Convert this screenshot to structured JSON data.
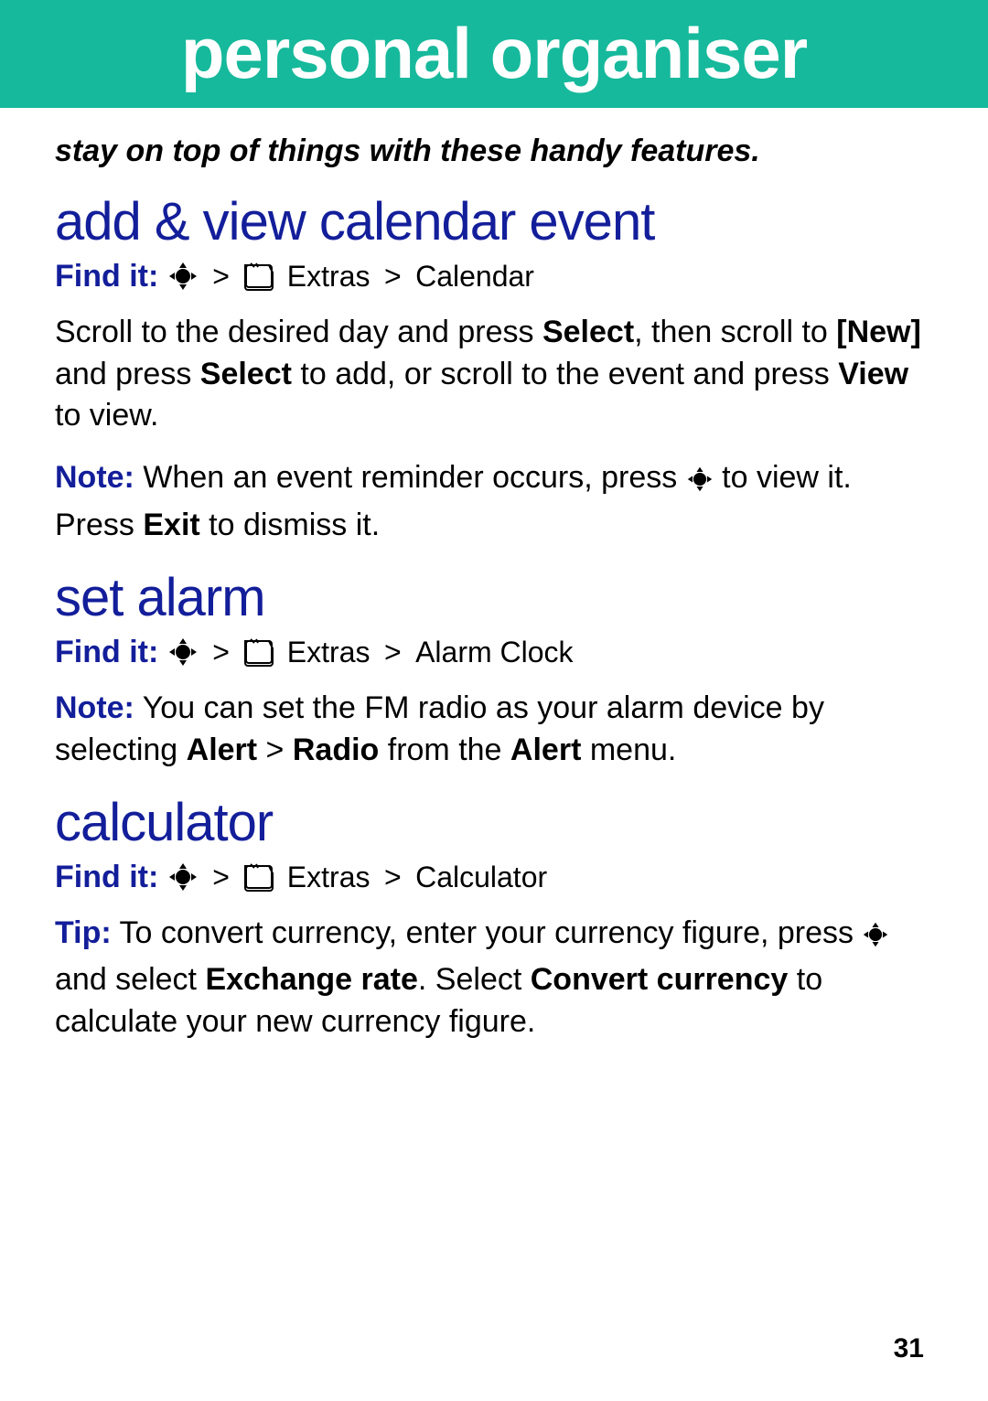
{
  "banner": {
    "title": "personal organiser"
  },
  "tagline": "stay on top of things with these handy features.",
  "sections": {
    "calendar": {
      "heading": "add & view calendar event",
      "findit_label": "Find it:",
      "gt": ">",
      "crumb1": "Extras",
      "crumb2": "Calendar",
      "para1_a": "Scroll to the desired day and press ",
      "para1_b": "Select",
      "para1_c": ", then scroll to ",
      "para1_d": "[New]",
      "para1_e": " and press ",
      "para1_f": "Select",
      "para1_g": " to add, or scroll to the event and press ",
      "para1_h": "View",
      "para1_i": " to view.",
      "note_label": "Note:",
      "note_a": " When an event reminder occurs, press ",
      "note_b": " to view it. Press ",
      "note_c": "Exit",
      "note_d": " to dismiss it."
    },
    "alarm": {
      "heading": "set alarm",
      "findit_label": "Find it:",
      "gt": ">",
      "crumb1": "Extras",
      "crumb2": "Alarm Clock",
      "note_label": "Note:",
      "note_a": " You can set the FM radio as your alarm device by selecting ",
      "note_b": "Alert",
      "note_c": " > ",
      "note_d": "Radio",
      "note_e": " from the ",
      "note_f": "Alert",
      "note_g": " menu."
    },
    "calculator": {
      "heading": "calculator",
      "findit_label": "Find it:",
      "gt": ">",
      "crumb1": "Extras",
      "crumb2": "Calculator",
      "tip_label": "Tip:",
      "tip_a": " To convert currency, enter your currency figure, press ",
      "tip_b": " and select ",
      "tip_c": "Exchange rate",
      "tip_d": ". Select ",
      "tip_e": "Convert currency",
      "tip_f": "  to calculate your new currency figure."
    }
  },
  "page_number": "31"
}
